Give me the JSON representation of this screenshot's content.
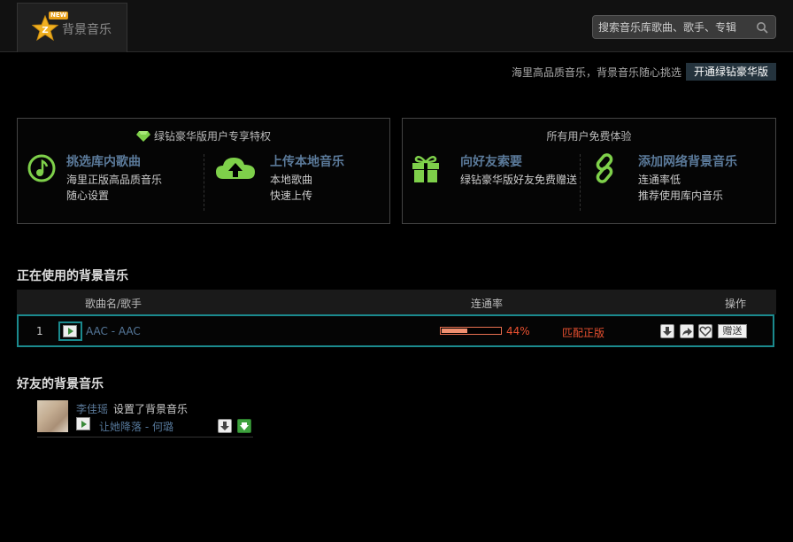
{
  "header": {
    "tab_label": "背景音乐",
    "new_badge": "NEW",
    "search_placeholder": "搜索音乐库歌曲、歌手、专辑"
  },
  "promo": {
    "text": "海里高品质音乐，背景音乐随心挑选",
    "upgrade_label": "开通绿钻豪华版"
  },
  "vip_box": {
    "title": "绿钻豪华版用户专享特权",
    "features": [
      {
        "title": "挑选库内歌曲",
        "line1": "海里正版高品质音乐",
        "line2": "随心设置",
        "icon": "music-note-icon"
      },
      {
        "title": "上传本地音乐",
        "line1": "本地歌曲",
        "line2": "快速上传",
        "icon": "cloud-upload-icon"
      }
    ]
  },
  "free_box": {
    "title": "所有用户免费体验",
    "features": [
      {
        "title": "向好友索要",
        "line1": "绿钻豪华版好友免费赠送",
        "line2": "",
        "icon": "gift-icon"
      },
      {
        "title": "添加网络背景音乐",
        "line1": "连通率低",
        "line2": "推荐使用库内音乐",
        "icon": "link-icon"
      }
    ]
  },
  "current": {
    "section_title": "正在使用的背景音乐",
    "columns": {
      "song": "歌曲名/歌手",
      "rate": "连通率",
      "actions": "操作"
    },
    "rows": [
      {
        "index": "1",
        "song": "AAC - AAC",
        "rate_percent": 44,
        "rate_text": "44%",
        "match": "匹配正版",
        "gift_label": "赠送"
      }
    ]
  },
  "friends": {
    "section_title": "好友的背景音乐",
    "items": [
      {
        "name": "李佳瑶",
        "action": "设置了背景音乐",
        "song": "让她降落 - 何璐"
      }
    ]
  },
  "colors": {
    "accent_green": "#7ed04a",
    "link_blue": "#5b7a9a",
    "highlight_teal": "#1b8a8e",
    "warning_red": "#e85030"
  }
}
